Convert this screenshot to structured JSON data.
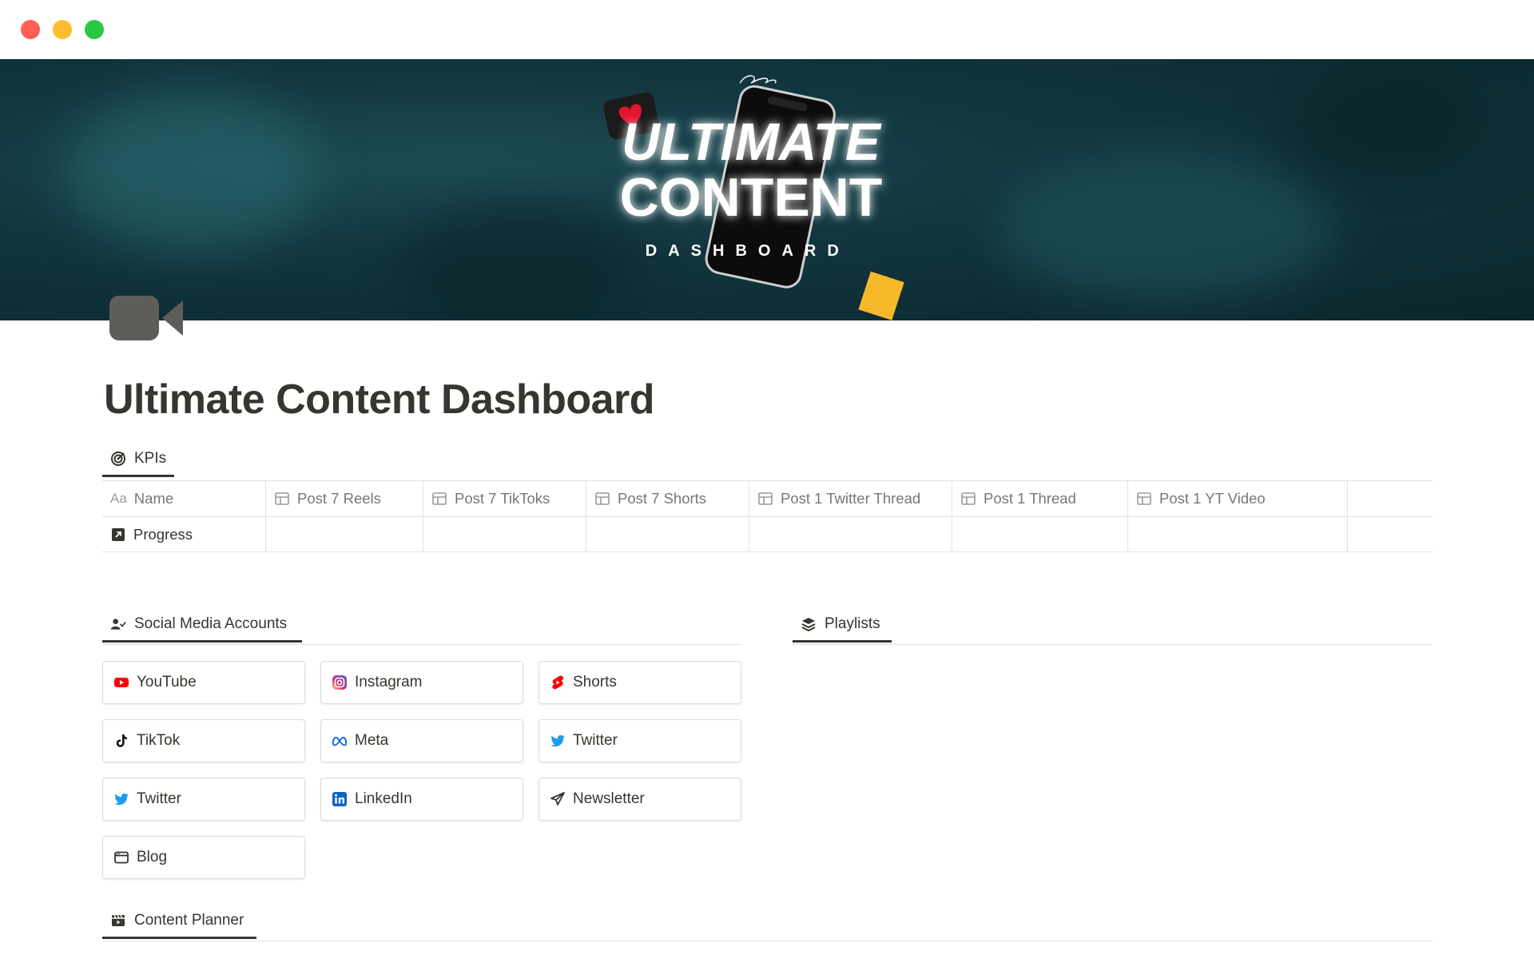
{
  "window": {
    "controls": [
      "close",
      "minimize",
      "maximize"
    ]
  },
  "cover": {
    "art_line1": "ULTIMATE",
    "art_line2": "CONTENT",
    "art_line3": "DASHBOARD"
  },
  "page": {
    "icon": "video-camera-icon",
    "title": "Ultimate Content Dashboard"
  },
  "kpis": {
    "tab_label": "KPIs",
    "tab_icon": "target-icon",
    "columns": [
      {
        "label": "Name",
        "icon": "text-aa-icon"
      },
      {
        "label": "Post 7 Reels",
        "icon": "button-property-icon"
      },
      {
        "label": "Post 7 TikToks",
        "icon": "button-property-icon"
      },
      {
        "label": "Post 7 Shorts",
        "icon": "button-property-icon"
      },
      {
        "label": "Post 1 Twitter Thread",
        "icon": "button-property-icon"
      },
      {
        "label": "Post 1 Thread",
        "icon": "button-property-icon"
      },
      {
        "label": "Post 1 YT Video",
        "icon": "button-property-icon"
      }
    ],
    "rows": [
      {
        "name": "Progress",
        "icon": "arrow-up-right-square-icon"
      }
    ]
  },
  "social": {
    "tab_label": "Social Media Accounts",
    "tab_icon": "person-check-icon",
    "items": [
      {
        "label": "YouTube",
        "icon": "youtube-icon",
        "color": "#ff0000"
      },
      {
        "label": "Instagram",
        "icon": "instagram-icon",
        "color": "#d62976"
      },
      {
        "label": "Shorts",
        "icon": "shorts-icon",
        "color": "#ff0000"
      },
      {
        "label": "TikTok",
        "icon": "tiktok-icon",
        "color": "#111111"
      },
      {
        "label": "Meta",
        "icon": "meta-icon",
        "color": "#0668e1"
      },
      {
        "label": "Twitter",
        "icon": "twitter-icon",
        "color": "#1d9bf0"
      },
      {
        "label": "Twitter",
        "icon": "twitter-icon",
        "color": "#1d9bf0"
      },
      {
        "label": "LinkedIn",
        "icon": "linkedin-icon",
        "color": "#0a66c2"
      },
      {
        "label": "Newsletter",
        "icon": "paper-plane-icon",
        "color": "#37352f"
      },
      {
        "label": "Blog",
        "icon": "browser-window-icon",
        "color": "#37352f"
      }
    ]
  },
  "playlists": {
    "tab_label": "Playlists",
    "tab_icon": "layers-icon"
  },
  "planner": {
    "tab_label": "Content Planner",
    "tab_icon": "clapperboard-icon"
  }
}
